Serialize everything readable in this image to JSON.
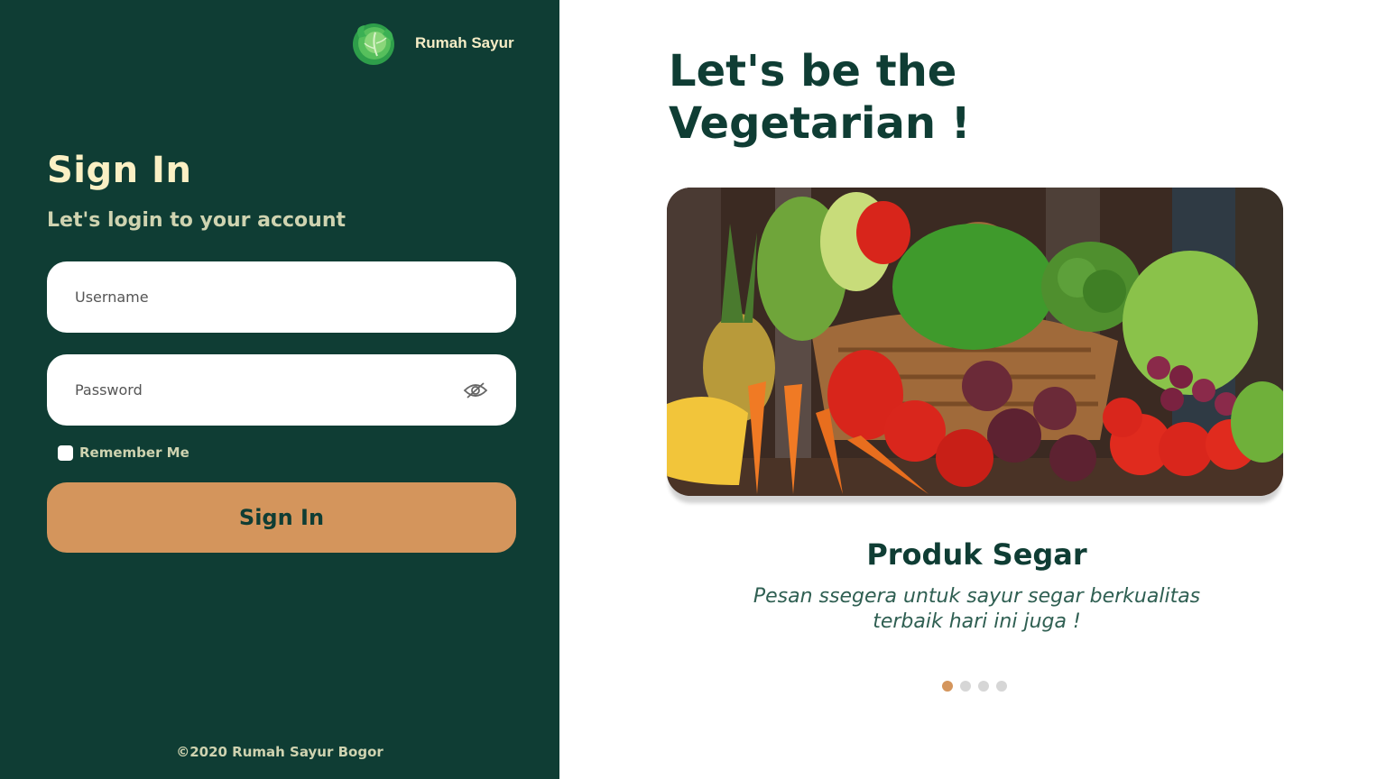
{
  "brand": {
    "name": "Rumah Sayur",
    "logo_icon": "cabbage-icon"
  },
  "login": {
    "title": "Sign In",
    "subtitle": "Let's login to your account",
    "username_placeholder": "Username",
    "username_value": "",
    "password_placeholder": "Password",
    "password_value": "",
    "toggle_icon": "eye-slash-icon",
    "remember_label": "Remember Me",
    "remember_checked": false,
    "button_label": "Sign In"
  },
  "footer": {
    "copyright": "©2020 Rumah Sayur Bogor"
  },
  "hero": {
    "title_line1": "Let's be the",
    "title_line2": "Vegetarian !",
    "image_description_icon": "vegetables-photo",
    "slide_title": "Produk Segar",
    "slide_desc_line1": "Pesan ssegera untuk sayur segar berkualitas",
    "slide_desc_line2": "terbaik hari ini juga !",
    "slides_total": 4,
    "active_slide": 1
  },
  "colors": {
    "panel_bg": "#0f3d34",
    "accent": "#d4955c",
    "title_cream": "#fbf0c4",
    "muted_text": "#cfd3b0",
    "dot_inactive": "#d6d6d6"
  }
}
